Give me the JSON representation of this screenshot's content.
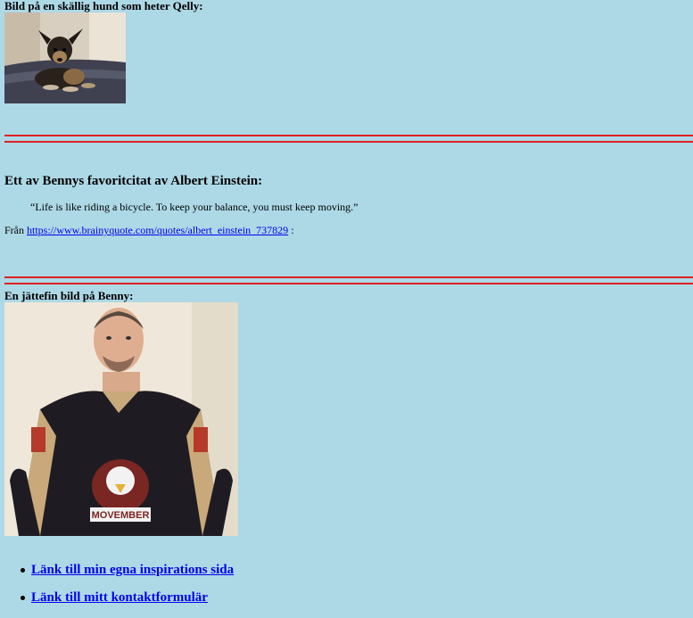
{
  "dog_section": {
    "label": "Bild på en skällig hund som heter Qelly:",
    "image_icon": "dog-photo"
  },
  "quote_section": {
    "heading": "Ett av Bennys favoritcitat av Albert Einstein:",
    "quote": "“Life is like riding a bicycle. To keep your balance, you must keep moving.”",
    "source_prefix": "Från",
    "source_link": "https://www.brainyquote.com/quotes/albert_einstein_737829",
    "source_suffix": ":"
  },
  "benny_section": {
    "label": "En jättefin bild på Benny:",
    "image_icon": "person-photo",
    "jersey_text": "MOVEMBER"
  },
  "nav_links": [
    {
      "label": "Länk till min egna inspirations sida"
    },
    {
      "label": "Länk till mitt kontaktformulär"
    }
  ],
  "colors": {
    "background": "#add8e6",
    "rule": "#dd2222",
    "link": "#0000ee"
  }
}
